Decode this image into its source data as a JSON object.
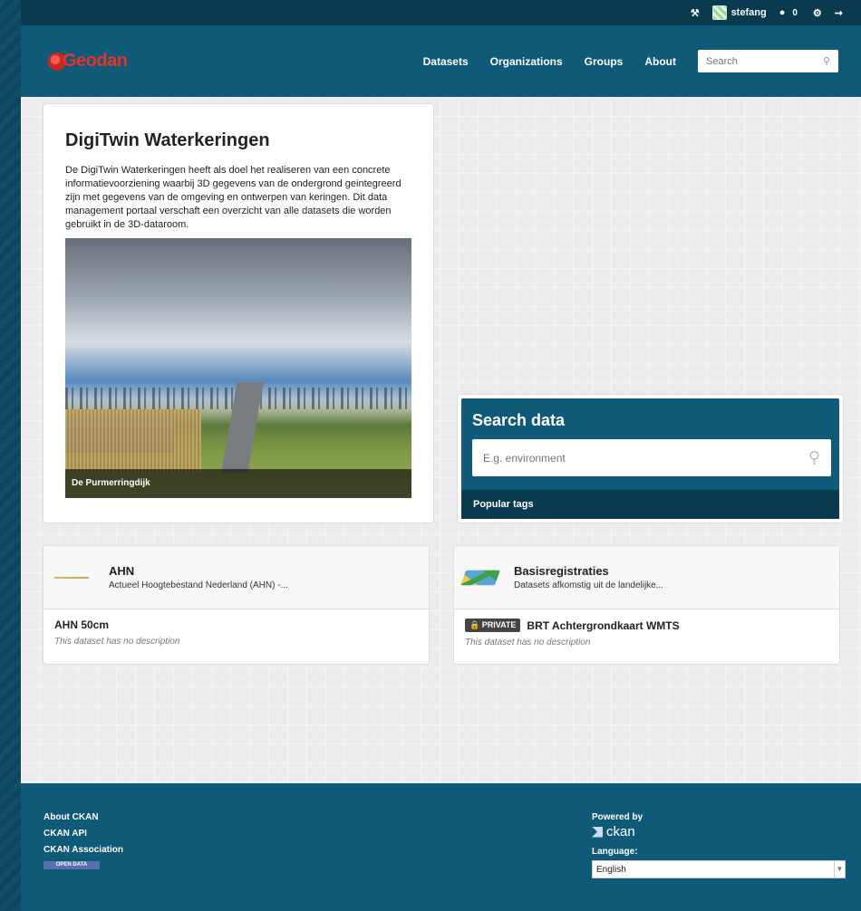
{
  "account": {
    "username": "stefang",
    "notifications": "0"
  },
  "header": {
    "logo": "Geodan",
    "nav": [
      "Datasets",
      "Organizations",
      "Groups",
      "About"
    ],
    "search_placeholder": "Search"
  },
  "hero": {
    "title": "DigiTwin Waterkeringen",
    "text": "De DigiTwin Waterkeringen heeft als doel het realiseren van een concrete informatievoorziening waarbij 3D gegevens van de ondergrond geintegreerd zijn met gegevens van de omgeving en ontwerpen van keringen. Dit data management portaal verschaft een overzicht van alle datasets die worden gebruikt in de 3D-dataroom.",
    "image_caption": "De Purmerringdijk"
  },
  "search": {
    "title": "Search data",
    "placeholder": "E.g. environment",
    "popular_tags": "Popular tags"
  },
  "groups": [
    {
      "title": "AHN",
      "description": "Actueel Hoogtebestand Nederland (AHN) -...",
      "dataset_title": "AHN 50cm",
      "dataset_desc": "This dataset has no description",
      "private": false
    },
    {
      "title": "Basisregistraties",
      "description": "Datasets afkomstig uit de landelijke...",
      "dataset_title": "BRT Achtergrondkaart WMTS",
      "dataset_desc": "This dataset has no description",
      "private": true,
      "private_label": "PRIVATE"
    }
  ],
  "footer": {
    "links": [
      "About CKAN",
      "CKAN API",
      "CKAN Association"
    ],
    "open_data": "OPEN DATA",
    "powered_by": "Powered by",
    "ckan": "ckan",
    "language_label": "Language:",
    "language_value": "English"
  }
}
